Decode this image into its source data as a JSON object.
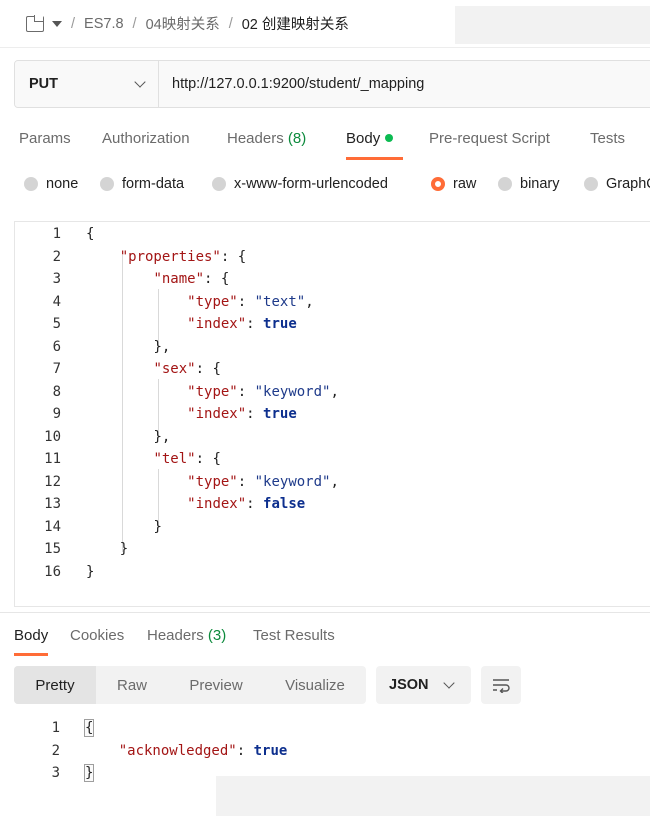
{
  "breadcrumb": {
    "icon": "collection-icon",
    "items": [
      "ES7.8",
      "04映射关系",
      "02 创建映射关系"
    ],
    "separator": "/"
  },
  "request": {
    "method": "PUT",
    "url": "http://127.0.0.1:9200/student/_mapping"
  },
  "request_tabs": [
    {
      "label": "Params"
    },
    {
      "label": "Authorization"
    },
    {
      "label": "Headers",
      "count": "(8)"
    },
    {
      "label": "Body",
      "active": true
    },
    {
      "label": "Pre-request Script"
    },
    {
      "label": "Tests"
    }
  ],
  "body_types": [
    "none",
    "form-data",
    "x-www-form-urlencoded",
    "raw",
    "binary",
    "GraphQL"
  ],
  "body_type_selected": "raw",
  "request_body_lines": [
    "{",
    "    \"properties\": {",
    "        \"name\": {",
    "            \"type\": \"text\",",
    "            \"index\": true",
    "        },",
    "        \"sex\": {",
    "            \"type\": \"keyword\",",
    "            \"index\": true",
    "        },",
    "        \"tel\": {",
    "            \"type\": \"keyword\",",
    "            \"index\": false",
    "        }",
    "    }",
    "}"
  ],
  "response_tabs": [
    {
      "label": "Body",
      "active": true
    },
    {
      "label": "Cookies"
    },
    {
      "label": "Headers",
      "count": "(3)"
    },
    {
      "label": "Test Results"
    }
  ],
  "response_views": [
    "Pretty",
    "Raw",
    "Preview",
    "Visualize"
  ],
  "response_view_selected": "Pretty",
  "response_format": "JSON",
  "response_body_lines": [
    "{",
    "    \"acknowledged\": true",
    "}"
  ],
  "colors": {
    "accent": "#ff6c37",
    "success": "#0cbb52",
    "count": "#0c8a3c"
  }
}
